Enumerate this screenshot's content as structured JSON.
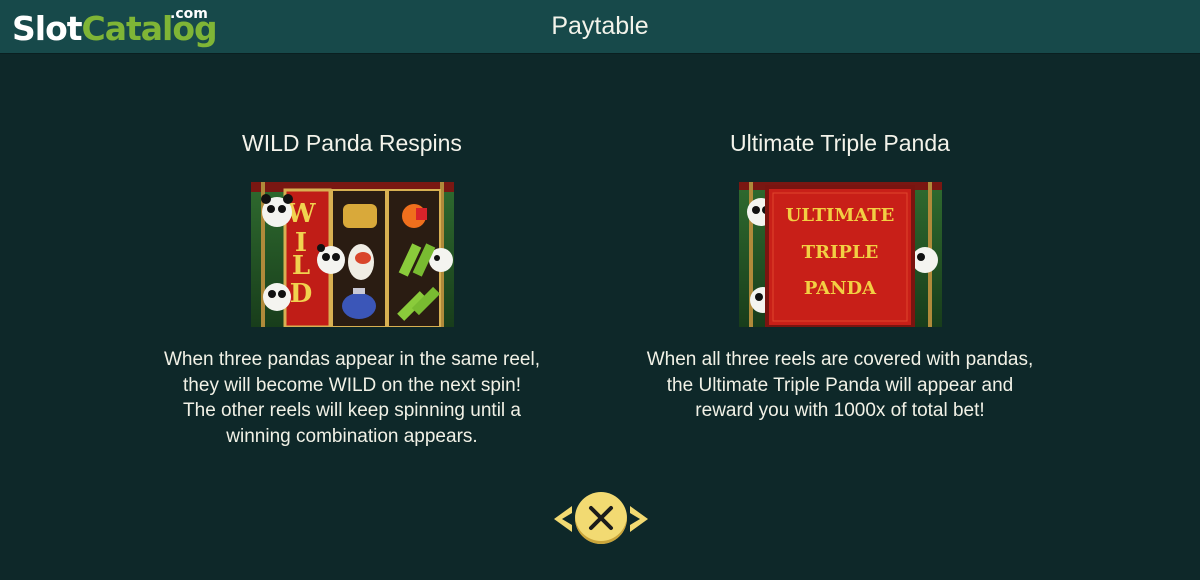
{
  "header": {
    "logo_slot": "Slot",
    "logo_catalog": "Catalog",
    "logo_com": ".com",
    "title": "Paytable"
  },
  "features": [
    {
      "title": "WILD Panda Respins",
      "description": "When three pandas appear in the same reel,\nthey will become WILD on the next spin!\nThe other reels will keep spinning until a\nwinning combination appears.",
      "image_text": "WILD"
    },
    {
      "title": "Ultimate Triple Panda",
      "description": "When all three reels are covered with pandas,\nthe Ultimate Triple Panda will appear and\nreward you with 1000x of total bet!",
      "image_text": [
        "ULTIMATE",
        "TRIPLE",
        "PANDA"
      ]
    }
  ],
  "nav": {
    "prev_icon": "chevron-left-icon",
    "close_icon": "close-icon",
    "next_icon": "chevron-right-icon"
  },
  "colors": {
    "background": "#0e2829",
    "header": "#17494a",
    "accent_yellow": "#f2da72",
    "logo_green": "#7fb536"
  }
}
